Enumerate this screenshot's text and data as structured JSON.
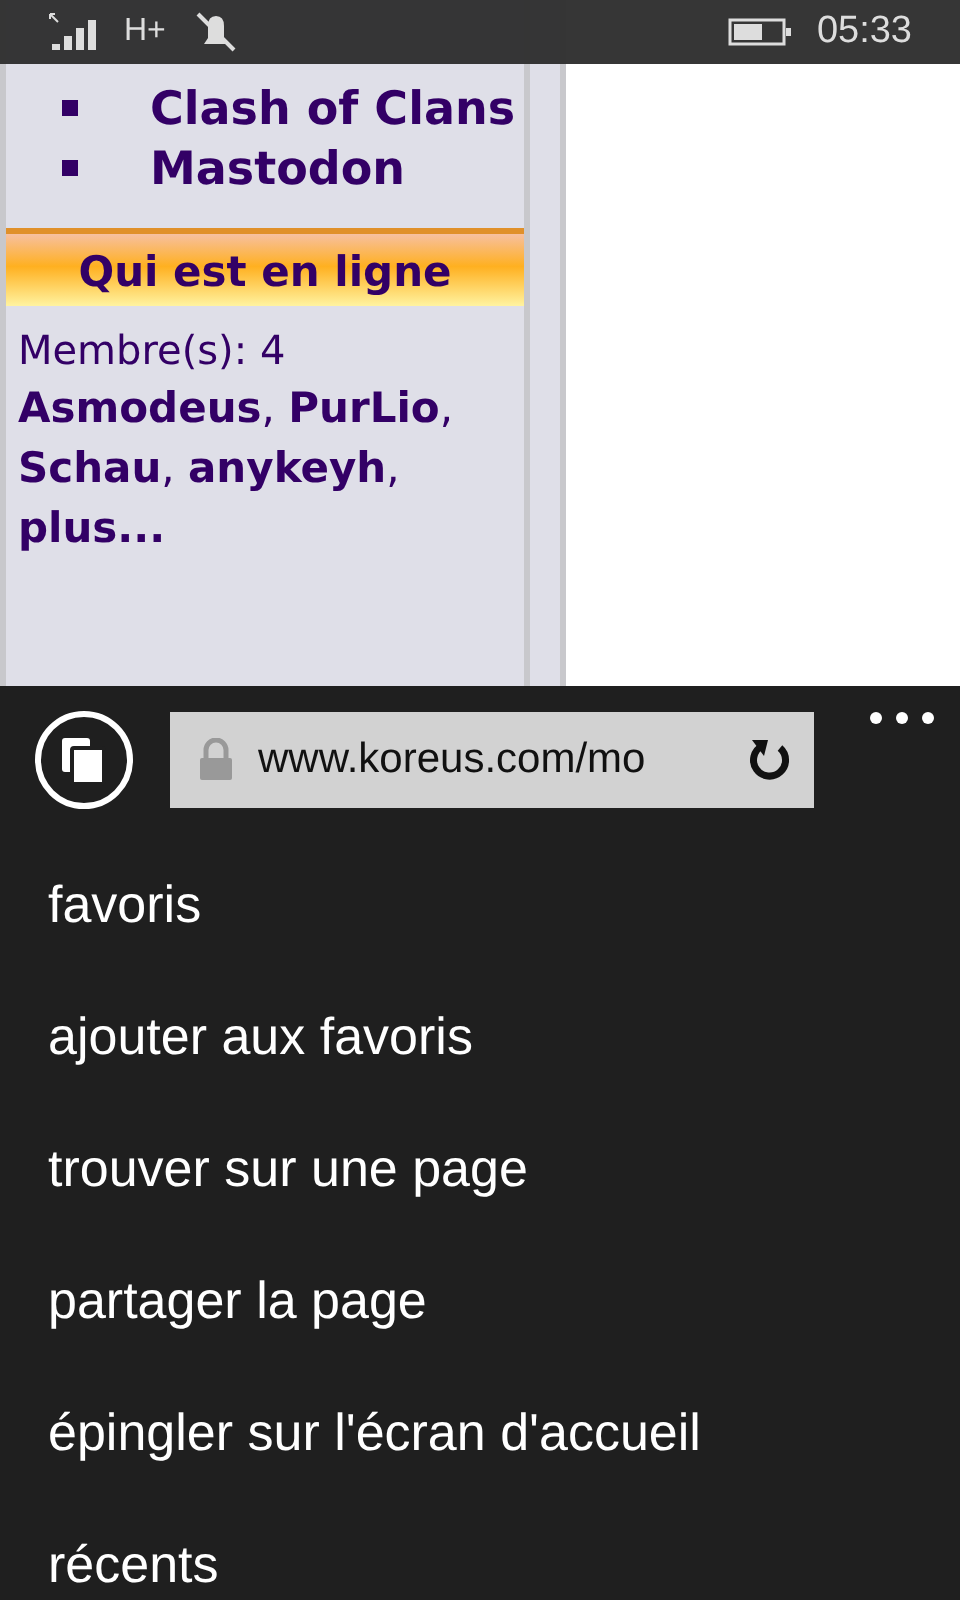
{
  "status_bar": {
    "network": "H+",
    "time": "05:33"
  },
  "page": {
    "links": [
      "Clash of Clans",
      "Mastodon"
    ],
    "online_heading": "Qui est en ligne",
    "members_count": "Membre(s): 4",
    "members": "**Asmodeus**, **PurLio**, **Schau**, **anykeyh**, **plus...**"
  },
  "address_bar": {
    "url": "www.koreus.com/mo"
  },
  "menu": [
    "favoris",
    "ajouter aux favoris",
    "trouver sur une page",
    "partager la page",
    "épingler sur l'écran d'accueil",
    "récents"
  ]
}
